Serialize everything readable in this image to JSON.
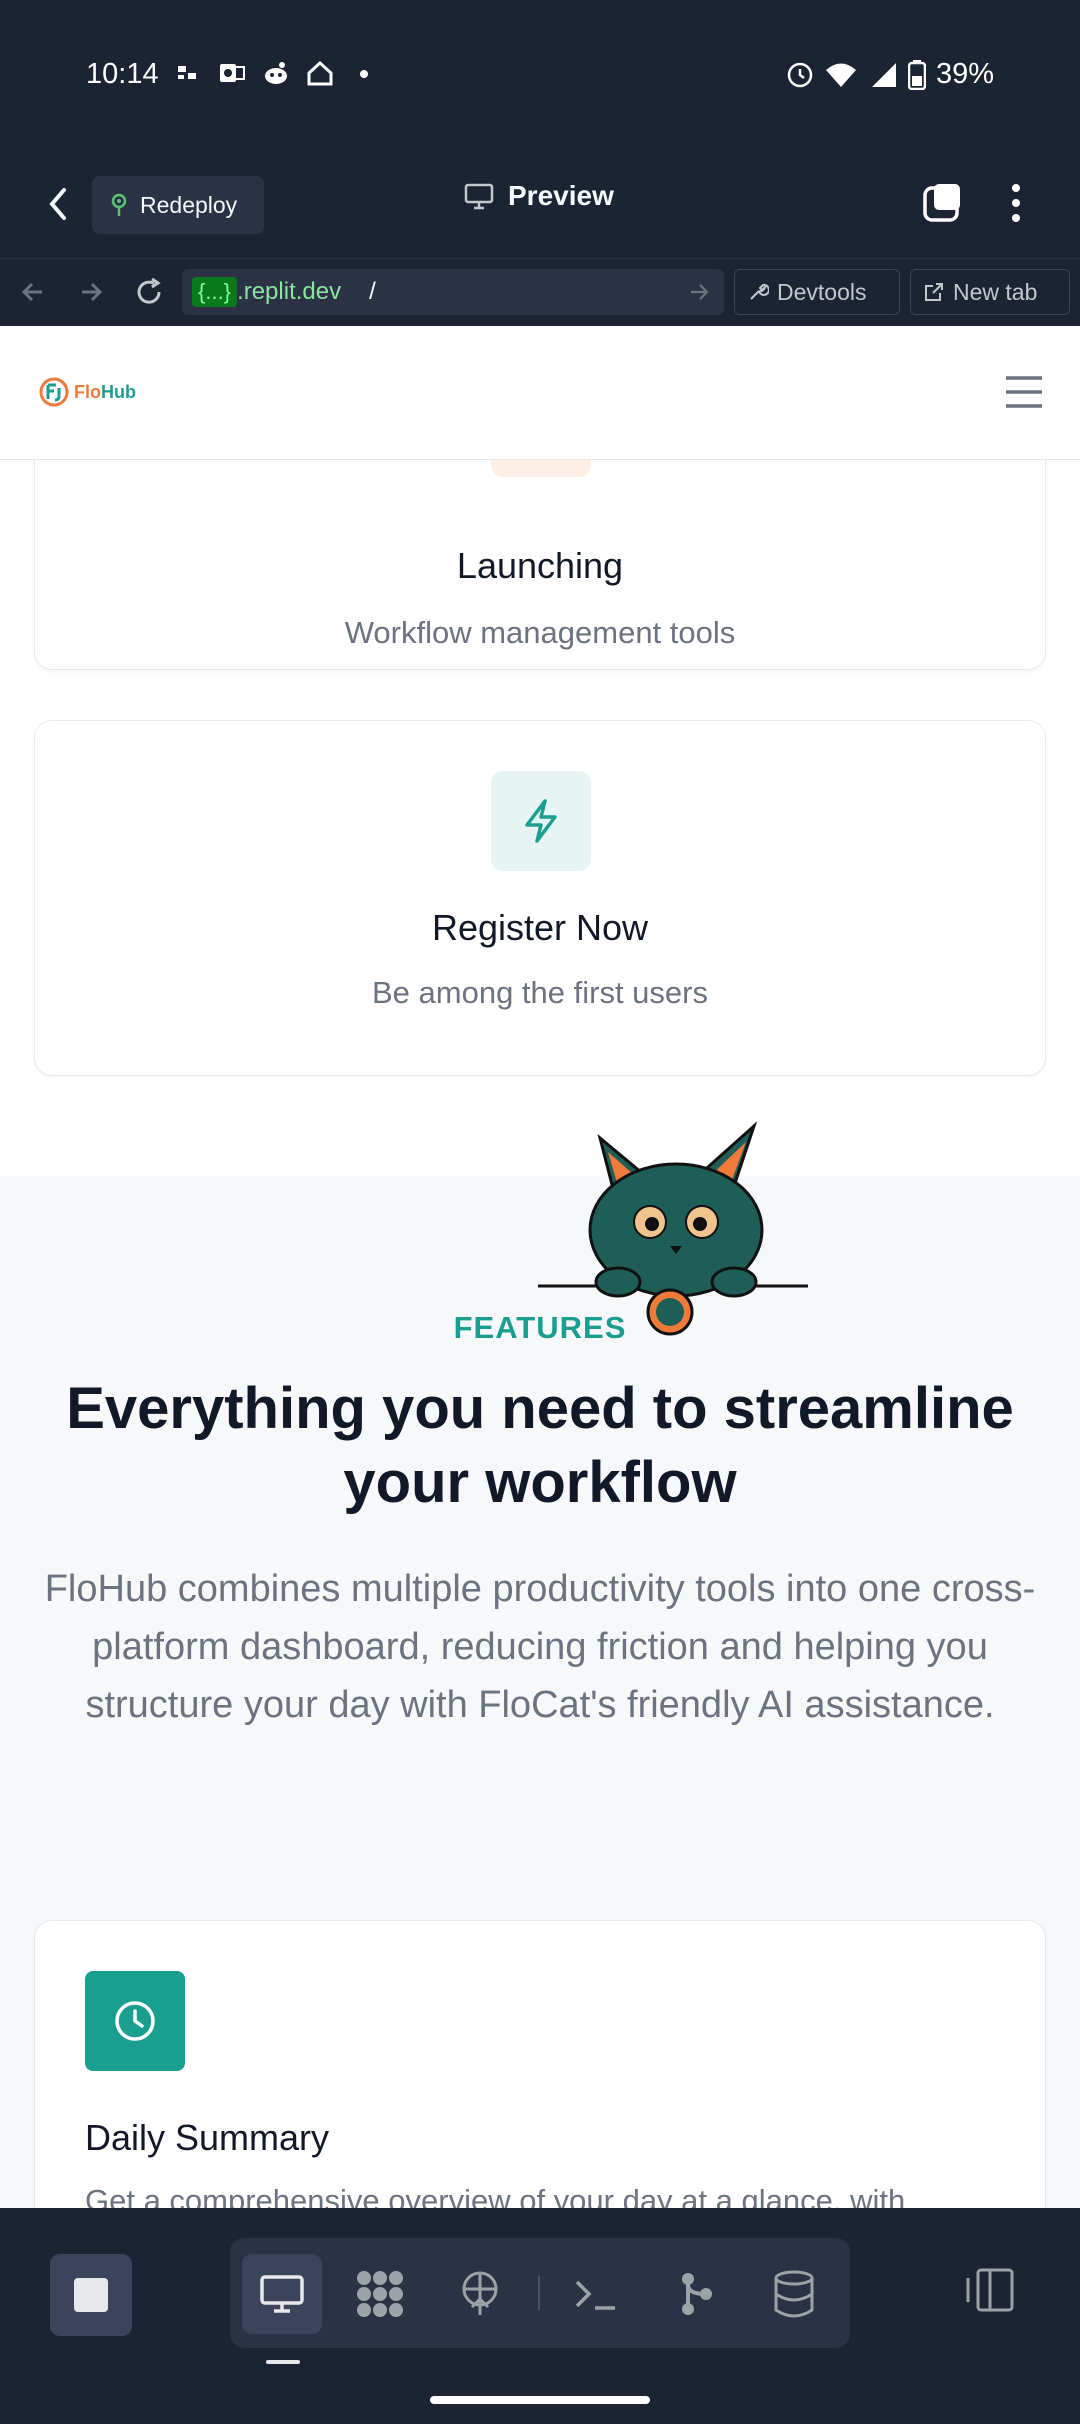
{
  "status_bar": {
    "time": "10:14",
    "battery": "39%"
  },
  "replit_header": {
    "redeploy_label": "Redeploy",
    "preview_label": "Preview"
  },
  "url_bar": {
    "domain_tag": "{...}",
    "domain": ".replit.dev",
    "path": "/",
    "devtools_label": "Devtools",
    "newtab_label": "New tab"
  },
  "site": {
    "logo_flo": "Flo",
    "logo_hub": "Hub",
    "cards": [
      {
        "title": "Launching",
        "subtitle": "Workflow management tools"
      },
      {
        "title": "Register Now",
        "subtitle": "Be among the first users"
      }
    ],
    "features": {
      "label": "FEATURES",
      "heading": "Everything you need to streamline your workflow",
      "description": "FloHub combines multiple productivity tools into one cross-platform dashboard, reducing friction and helping you structure your day with FloCat's friendly AI assistance."
    },
    "daily_summary": {
      "title": "Daily Summary",
      "text": "Get a comprehensive overview of your day at a glance, with"
    }
  },
  "colors": {
    "brand_teal": "#1a9e8f",
    "brand_orange": "#f07a3a",
    "chrome_bg": "#1c2333"
  }
}
